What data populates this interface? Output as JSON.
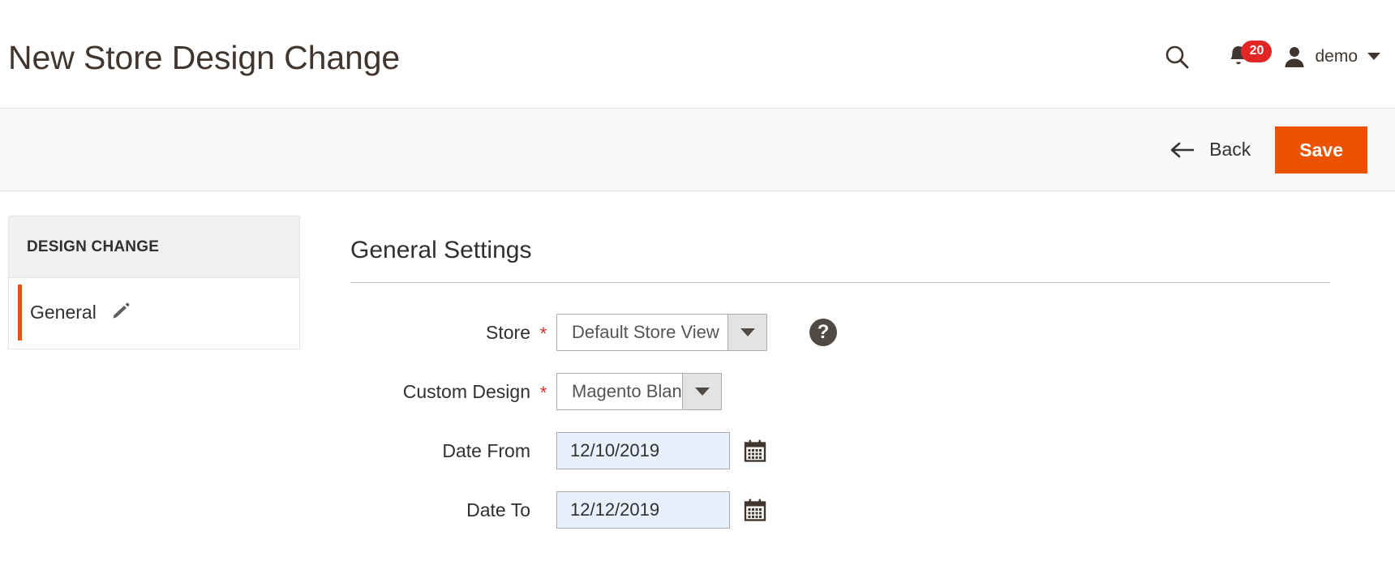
{
  "header": {
    "title": "New Store Design Change",
    "search_icon": "search-icon",
    "notifications_icon": "bell-icon",
    "notifications_count": "20",
    "user_icon": "user-avatar-icon",
    "user_name": "demo",
    "user_caret": "chevron-down-icon"
  },
  "toolbar": {
    "back_label": "Back",
    "back_icon": "arrow-left-icon",
    "save_label": "Save"
  },
  "sidebar": {
    "title": "DESIGN CHANGE",
    "items": [
      {
        "label": "General",
        "icon": "pencil-icon",
        "active": true
      }
    ]
  },
  "content": {
    "section_title": "General Settings",
    "fields": [
      {
        "label": "Store",
        "required": "*",
        "type": "select",
        "value": "Default Store View",
        "caret_icon": "chevron-down-icon",
        "help_icon": "question-mark-icon"
      },
      {
        "label": "Custom Design",
        "required": "*",
        "type": "select",
        "value": "Magento Blank",
        "caret_icon": "chevron-down-icon"
      },
      {
        "label": "Date From",
        "required": "",
        "type": "date",
        "value": "12/10/2019",
        "placeholder": "MM/DD/YYYY",
        "calendar_icon": "calendar-icon"
      },
      {
        "label": "Date To",
        "required": "",
        "type": "date",
        "value": "12/12/2019",
        "placeholder": "MM/DD/YYYY",
        "calendar_icon": "calendar-icon"
      }
    ]
  },
  "colors": {
    "accent_orange": "#eb5202",
    "badge_red": "#e22626",
    "required_red": "#e02b27",
    "text_dark": "#303030",
    "toolbar_bg": "#f8f8f8",
    "autofill_blue": "#e8f0fe"
  }
}
